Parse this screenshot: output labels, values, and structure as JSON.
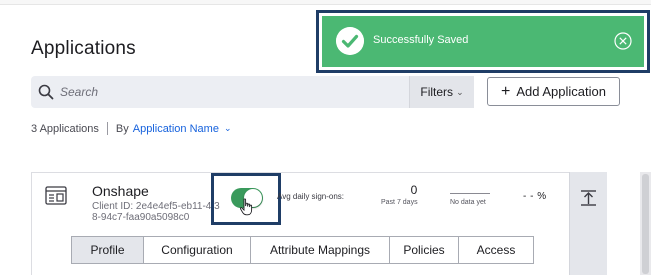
{
  "page": {
    "title": "Applications"
  },
  "search": {
    "placeholder": "Search"
  },
  "filters": {
    "label": "Filters"
  },
  "add_button": {
    "label": "Add Application"
  },
  "summary": {
    "count_text": "3 Applications",
    "sort_prefix": "By",
    "sort_value": "Application Name"
  },
  "app": {
    "name": "Onshape",
    "client_id": "Client ID: 2e4e4ef5-eb11-4f38-94c7-faa90a5098c0",
    "enabled": true,
    "metric_label": "Avg daily sign-ons:",
    "sign_ons_value": "0",
    "sign_ons_period": "Past 7 days",
    "trend_text": "No data yet",
    "percent": "- - %"
  },
  "tabs": [
    {
      "label": "Profile",
      "active": true
    },
    {
      "label": "Configuration",
      "active": false
    },
    {
      "label": "Attribute Mappings",
      "active": false
    },
    {
      "label": "Policies",
      "active": false
    },
    {
      "label": "Access",
      "active": false
    }
  ],
  "toast": {
    "message": "Successfully Saved",
    "color": "#4bb873"
  },
  "colors": {
    "accent": "#1662dd",
    "toggle_on": "#3a9a5c",
    "highlight": "#1f3d66"
  },
  "icons": [
    "search-icon",
    "chevron-down-icon",
    "plus-icon",
    "app-window-icon",
    "collapse-top-icon",
    "check-circle-icon",
    "close-circle-icon",
    "hand-cursor-icon"
  ]
}
